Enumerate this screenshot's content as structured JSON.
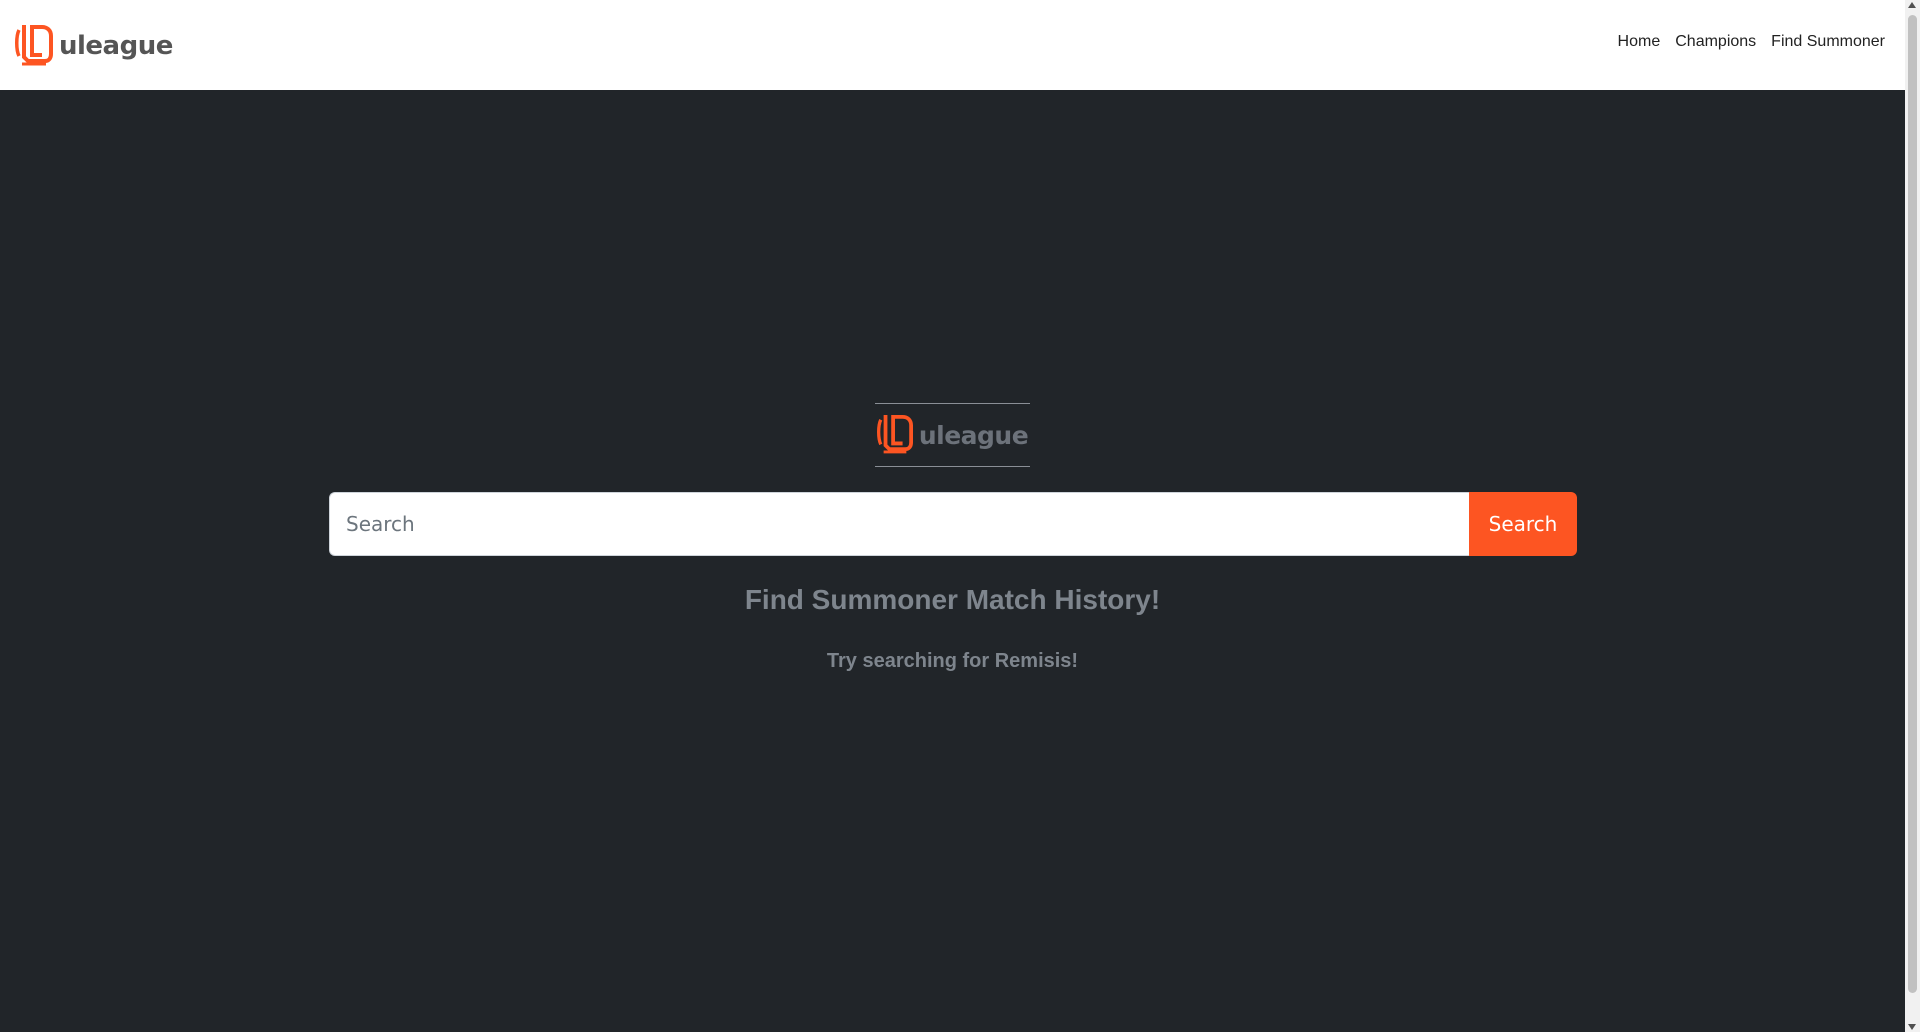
{
  "colors": {
    "accent": "#fd5522",
    "background": "#212529",
    "navbar": "#ffffff",
    "muted_text": "#7e858d"
  },
  "navbar": {
    "brand_text": "uleague",
    "brand_icon": "uleague-logo-icon",
    "links": [
      {
        "label": "Home"
      },
      {
        "label": "Champions"
      },
      {
        "label": "Find Summoner"
      }
    ]
  },
  "hero": {
    "logo_text": "uleague",
    "logo_icon": "uleague-logo-icon"
  },
  "search": {
    "placeholder": "Search",
    "value": "",
    "button_label": "Search"
  },
  "headline": "Find Summoner Match History!",
  "subline": "Try searching for Remisis!"
}
